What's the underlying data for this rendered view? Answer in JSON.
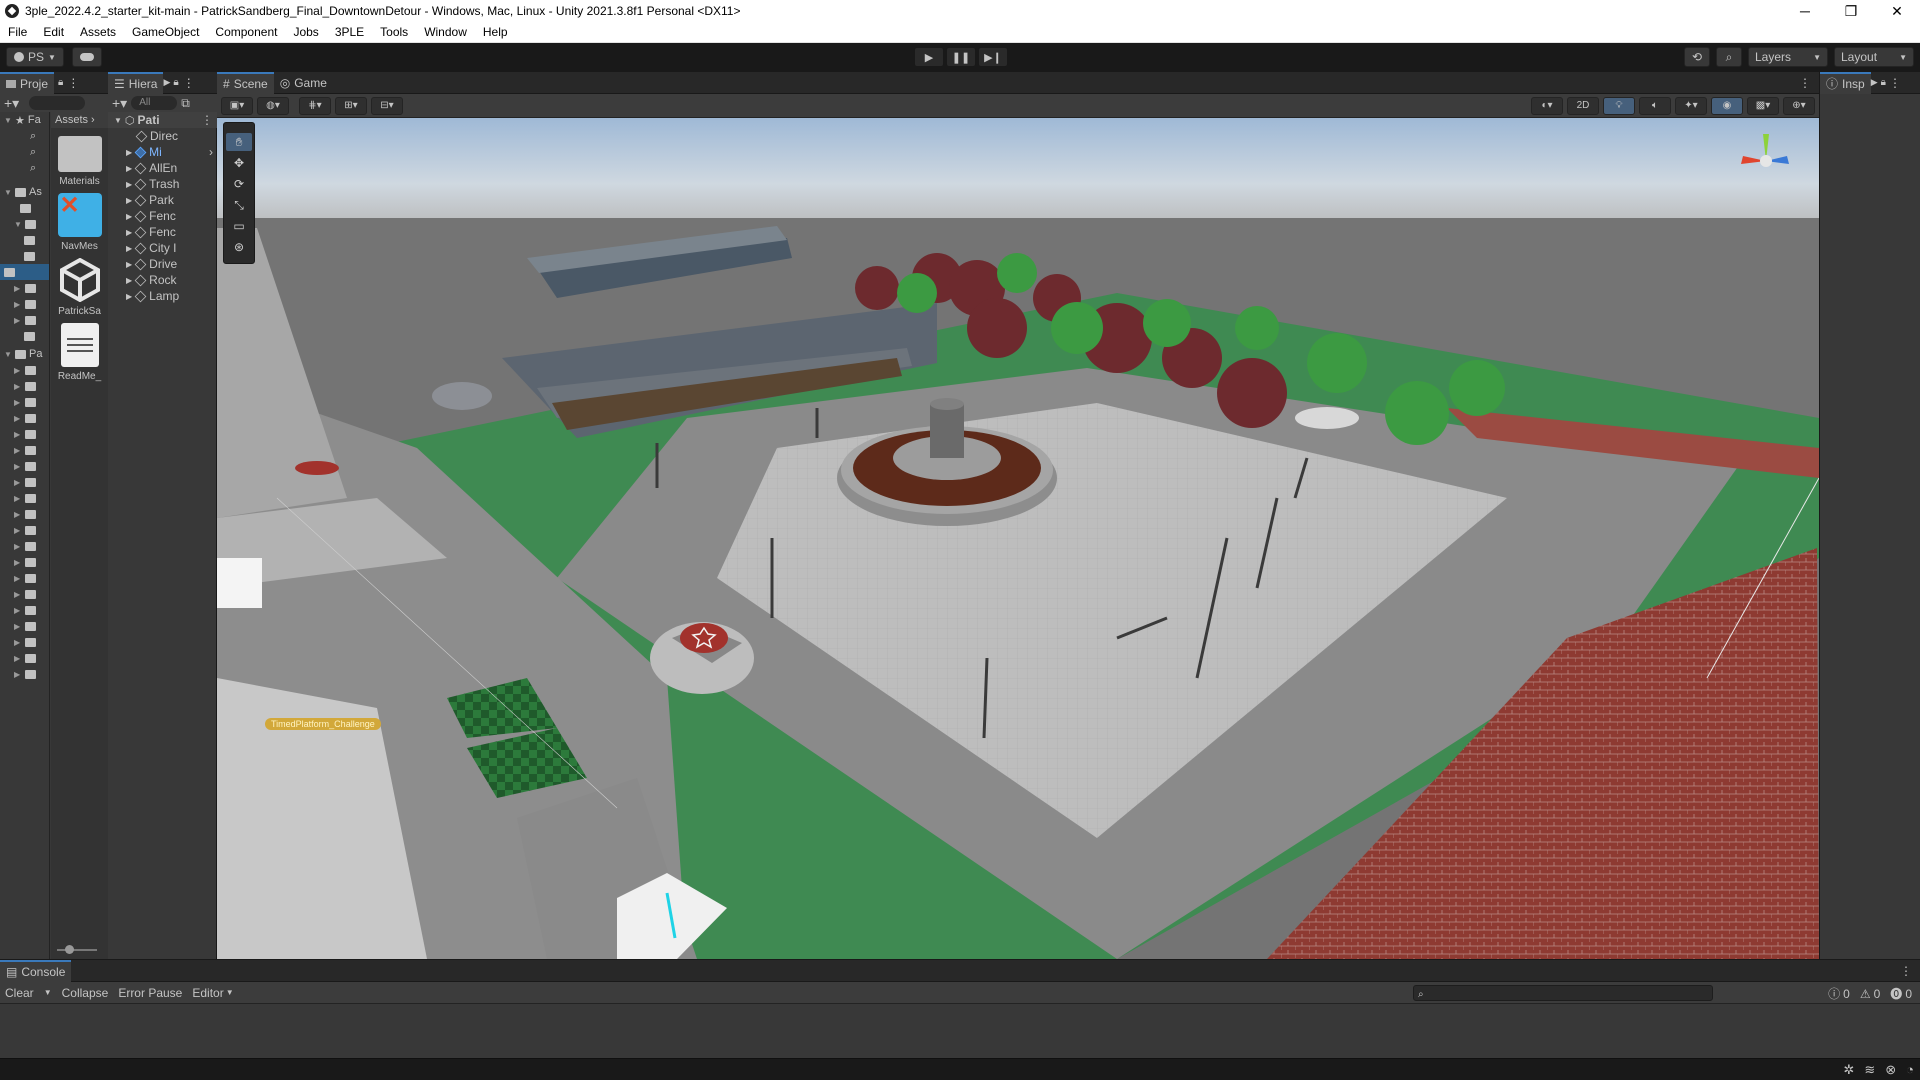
{
  "window": {
    "title": "3ple_2022.4.2_starter_kit-main - PatrickSandberg_Final_DowntownDetour - Windows, Mac, Linux - Unity 2021.3.8f1 Personal <DX11>",
    "minimize_glyph": "─",
    "maximize_glyph": "❐",
    "close_glyph": "✕"
  },
  "menu": [
    "File",
    "Edit",
    "Assets",
    "GameObject",
    "Component",
    "Jobs",
    "3PLE",
    "Tools",
    "Window",
    "Help"
  ],
  "toolbar": {
    "account": "PS",
    "play_glyph": "▶",
    "pause_glyph": "❚❚",
    "step_glyph": "▶❙",
    "layers": "Layers",
    "layout": "Layout"
  },
  "project": {
    "tab": "Proje",
    "search_placeholder": "",
    "tree_favorites": "Fa",
    "tree_assets": "As",
    "tree_packages": "Pa",
    "breadcrumb": "Assets",
    "assets": [
      {
        "name": "Materials",
        "icon": "folder-icon"
      },
      {
        "name": "NavMes",
        "icon": "navmesh-icon"
      },
      {
        "name": "PatrickSa",
        "icon": "unity-scene-icon"
      },
      {
        "name": "ReadMe_",
        "icon": "document-icon"
      }
    ]
  },
  "hierarchy": {
    "tab": "Hiera",
    "search_placeholder": "All",
    "scene_root": "Pati",
    "items": [
      "Direc",
      "Mi",
      "AllEn",
      "Trash",
      "Park",
      "Fenc",
      "Fenc",
      "City I",
      "Drive",
      "Rock",
      "Lamp"
    ]
  },
  "scene": {
    "tab_scene": "Scene",
    "tab_game": "Game",
    "mode_2d": "2D",
    "label_timed_platform": "TimedPlatform_Challenge"
  },
  "inspector": {
    "tab": "Insp"
  },
  "console": {
    "tab": "Console",
    "clear": "Clear",
    "collapse": "Collapse",
    "error_pause": "Error Pause",
    "editor": "Editor",
    "info_count": "0",
    "warning_count": "0",
    "error_count": "0"
  },
  "colors": {
    "accent_blue": "#3a79bb",
    "grass": "#3f8a52",
    "brick": "#8e3a32",
    "plaza": "#bdbdbd"
  }
}
